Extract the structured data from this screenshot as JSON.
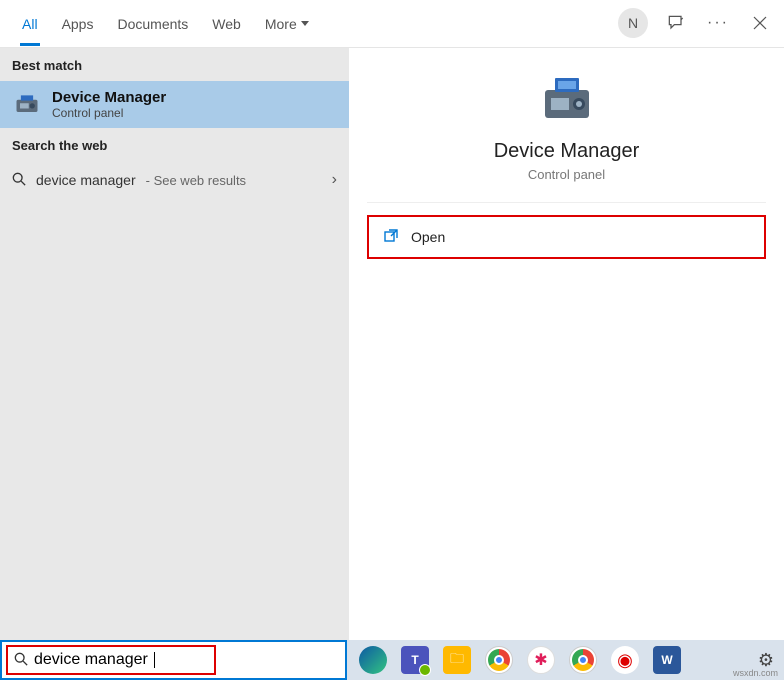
{
  "tabs": {
    "all": "All",
    "apps": "Apps",
    "documents": "Documents",
    "web": "Web",
    "more": "More"
  },
  "header": {
    "avatar": "N"
  },
  "left": {
    "best_match_label": "Best match",
    "best_title": "Device Manager",
    "best_sub": "Control panel",
    "search_web_label": "Search the web",
    "web_query": "device manager",
    "web_sub": " - See web results"
  },
  "right": {
    "title": "Device Manager",
    "sub": "Control panel",
    "open": "Open"
  },
  "search": {
    "value": "device manager"
  },
  "watermark": "wsxdn.com"
}
